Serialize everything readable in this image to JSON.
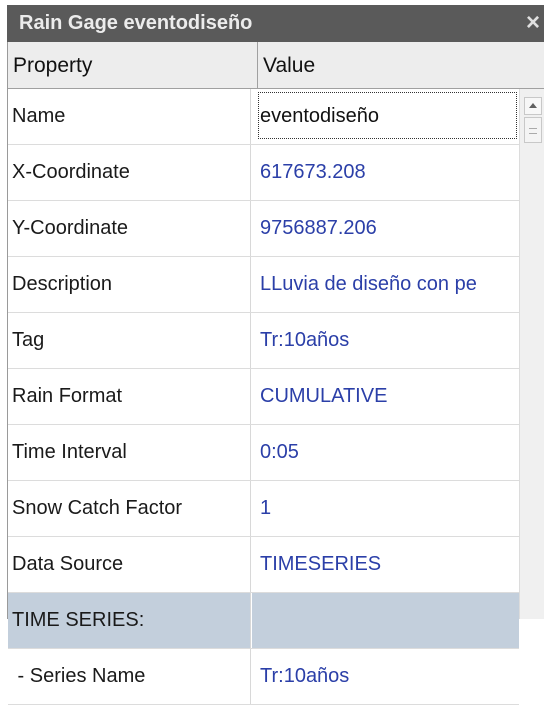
{
  "window": {
    "title": "Rain Gage eventodiseño",
    "close_glyph": "×"
  },
  "grid": {
    "header": {
      "property": "Property",
      "value": "Value"
    },
    "rows": [
      {
        "property": "Name",
        "value": "eventodiseño"
      },
      {
        "property": "X-Coordinate",
        "value": "617673.208"
      },
      {
        "property": "Y-Coordinate",
        "value": "9756887.206"
      },
      {
        "property": "Description",
        "value": "LLuvia de diseño con pe"
      },
      {
        "property": "Tag",
        "value": "Tr:10años"
      },
      {
        "property": "Rain Format",
        "value": "CUMULATIVE"
      },
      {
        "property": "Time Interval",
        "value": "0:05"
      },
      {
        "property": "Snow Catch Factor",
        "value": "1"
      },
      {
        "property": "Data Source",
        "value": "TIMESERIES"
      },
      {
        "property": "TIME SERIES:",
        "value": ""
      },
      {
        "property": " - Series Name",
        "value": "Tr:10años"
      }
    ]
  },
  "colors": {
    "title_bar": "#5a5a5a",
    "value_text": "#2b3fa8",
    "section_row": "#c3cfdc"
  },
  "icons": {
    "close": "close-icon",
    "scroll_up": "scroll-up-arrow-icon"
  }
}
